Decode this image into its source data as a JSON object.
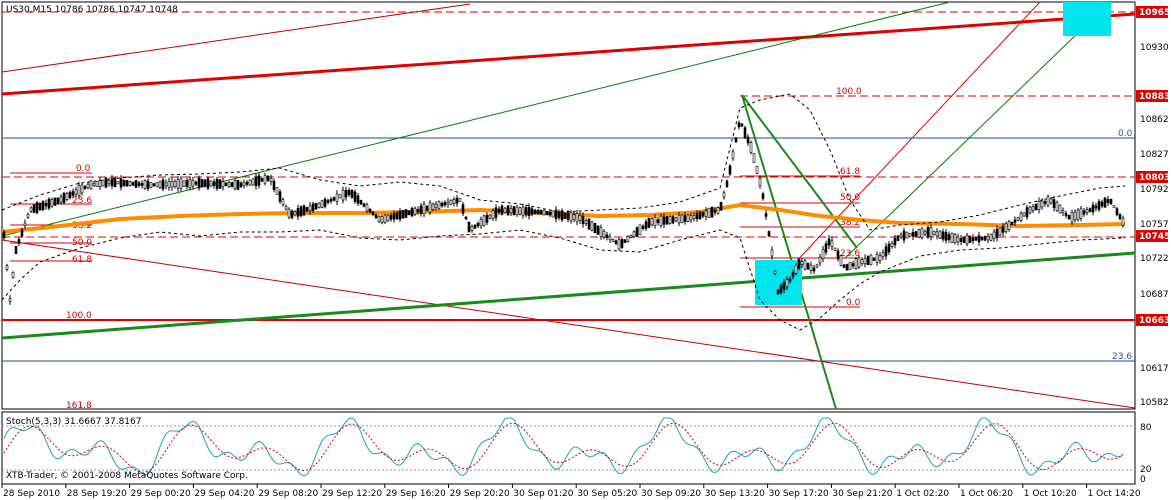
{
  "header": {
    "symbol_line": "US30,M15  10786 10786 10747 10748"
  },
  "copyright": "XTB-Trader, © 2001-2008 MetaQuotes Software Corp.",
  "stoch_label": "Stoch(5,3,3) 31.6667 37.8167",
  "price_axis": {
    "ticks": [
      "10930",
      "10862",
      "10827",
      "10792",
      "10757",
      "10722",
      "10687",
      "10617",
      "10582"
    ],
    "badges": [
      {
        "label": "10965",
        "color": "#e00000"
      },
      {
        "label": "10883",
        "color": "#e00000"
      },
      {
        "label": "10803",
        "color": "#e00000"
      },
      {
        "label": "10745",
        "color": "#e00000"
      },
      {
        "label": "10663",
        "color": "#e00000"
      }
    ]
  },
  "stoch_axis": {
    "ticks": [
      "80",
      "20",
      "0"
    ]
  },
  "time_axis": {
    "labels": [
      "28 Sep 2010",
      "28 Sep 19:20",
      "29 Sep 00:20",
      "29 Sep 04:20",
      "29 Sep 08:20",
      "29 Sep 12:20",
      "29 Sep 16:20",
      "29 Sep 20:20",
      "30 Sep 01:20",
      "30 Sep 05:20",
      "30 Sep 09:20",
      "30 Sep 13:20",
      "30 Sep 17:20",
      "30 Sep 21:20",
      "1 Oct 02:20",
      "1 Oct 06:20",
      "1 Oct 10:20",
      "1 Oct 14:20"
    ]
  },
  "fib_left": [
    "0.0",
    "23.6",
    "38.2",
    "50.0",
    "61.8",
    "100.0",
    "161.8"
  ],
  "fib_right": [
    "100.0",
    "61.8",
    "50.0",
    "38.2",
    "23.6",
    "0.0"
  ],
  "fib_blue": [
    "0.0",
    "23.6"
  ],
  "colors": {
    "red": "#e00000",
    "green": "#008000",
    "orange": "#ff8c00",
    "blue": "#2040a0",
    "cyan": "#00e0e0",
    "stoch_main": "#20a0c0",
    "stoch_signal": "#e00000"
  }
}
